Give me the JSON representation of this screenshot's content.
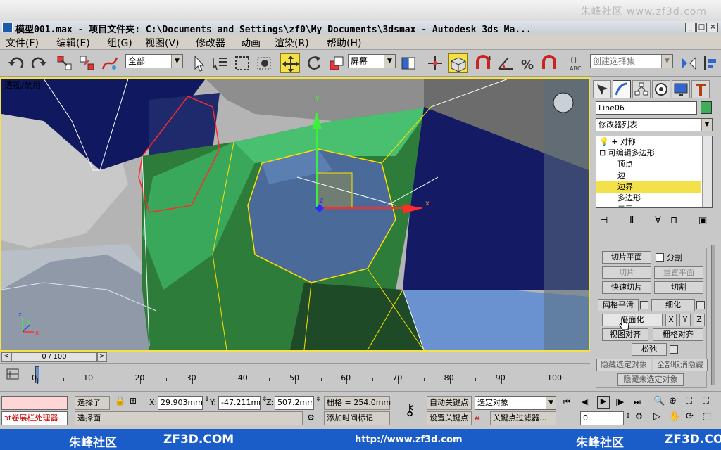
{
  "watermark_top": "朱峰社区 www.zf3d.com",
  "title": {
    "text": "模型001.max      - 项目文件夹: C:\\Documents and Settings\\zf0\\My Documents\\3dsmax     - Autodesk 3ds Ma...",
    "min": "_",
    "max": "□",
    "close": "×"
  },
  "menu": [
    "文件(F)",
    "编辑(E)",
    "组(G)",
    "视图(V)",
    "修改器",
    "动画",
    "渲染(R)",
    "帮助(H)"
  ],
  "toolbar": {
    "filter_value": "全部",
    "coord_value": "屏幕",
    "selection_set_placeholder": "创建选择集",
    "angle_snap_label": "3"
  },
  "viewport": {
    "label": "透视/禁用",
    "gizmo": {
      "x": "x",
      "y": "y",
      "z": "z"
    },
    "corner_axes": {
      "x": "x",
      "y": "y",
      "z": "z"
    }
  },
  "panel": {
    "object_name": "Line06",
    "object_color": "#3fae5a",
    "modifier_list": "修改器列表",
    "stack": [
      {
        "label": "对称",
        "level": 0,
        "expander": "+"
      },
      {
        "label": "可编辑多边形",
        "level": 0,
        "expander": "-"
      },
      {
        "label": "顶点",
        "level": 1
      },
      {
        "label": "边",
        "level": 1
      },
      {
        "label": "边界",
        "level": 1,
        "selected": true
      },
      {
        "label": "多边形",
        "level": 1
      },
      {
        "label": "元素",
        "level": 1
      }
    ],
    "buttons": {
      "slice_plane": "切片平面",
      "split": "分割",
      "slice": "切片",
      "reset_plane": "重置平面",
      "quickslice": "快速切片",
      "cut": "切割",
      "meshsmooth": "网格平滑",
      "tessellate": "细化",
      "make_planar": "平面化",
      "x": "X",
      "y": "Y",
      "z": "Z",
      "view_align": "视图对齐",
      "grid_align": "栅格对齐",
      "relax": "松弛",
      "hide_selected": "隐藏选定对象",
      "unhide_all": "全部取消隐藏",
      "hide_unselected": "隐藏未选定对象"
    }
  },
  "timeline": {
    "frame_label": "0 / 100",
    "ticks": [
      "0",
      "10",
      "20",
      "30",
      "40",
      "50",
      "60",
      "70",
      "80",
      "90",
      "100"
    ]
  },
  "status": {
    "mini_listener": "",
    "script_error": "ɔt卷展栏处理器",
    "selected_text": "选择了",
    "x_label": "X:",
    "x_value": "29.903mm",
    "y_label": "Y:",
    "y_value": "-47.211mm",
    "z_label": "Z:",
    "z_value": "507.2mm",
    "grid": "栅格 = 254.0mm",
    "prompt": "选择面",
    "add_time_tag": "添加时间标记",
    "auto_key": "自动关键点",
    "set_key": "设置关键点",
    "selected_objects": "选定对象",
    "key_filters": "关键点过滤器...",
    "current_frame": "0"
  },
  "footer": {
    "left_brand": "朱峰社区",
    "left_site": "ZF3D.COM",
    "url": "http://www.zf3d.com",
    "right_brand": "朱峰社区",
    "right_site": "ZF3D.COM"
  }
}
